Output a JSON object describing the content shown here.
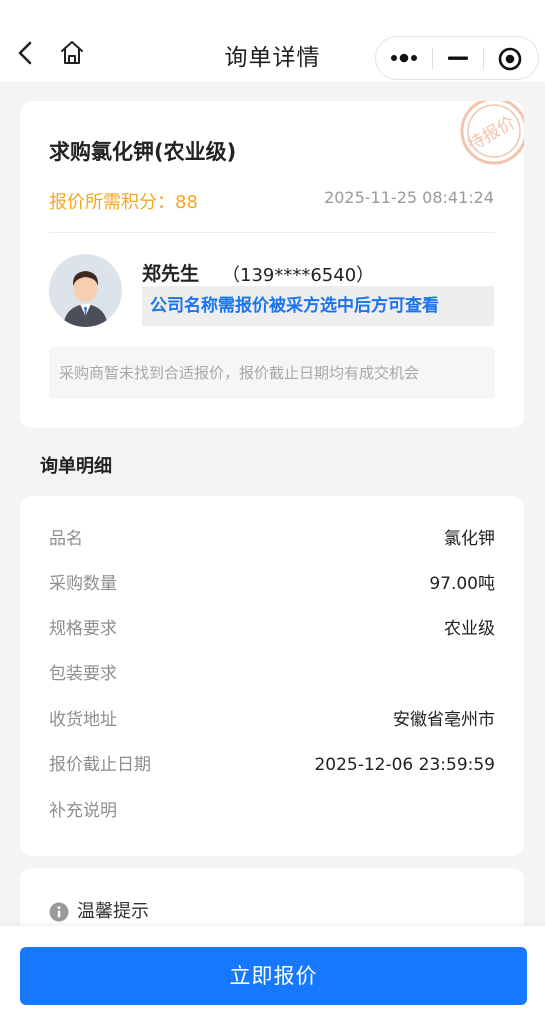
{
  "navbar": {
    "title": "询单详情",
    "back_icon": "chevron-left-icon",
    "home_icon": "home-icon",
    "capsule": {
      "more_icon": "more-dots-icon",
      "minimize_icon": "minimize-icon",
      "close_icon": "target-close-icon"
    }
  },
  "inquiry": {
    "title": "求购氯化钾(农业级)",
    "points_label": "报价所需积分：",
    "points_value": "88",
    "post_time": "2025-11-25 08:41:24",
    "stamp_text": "待报价",
    "buyer": {
      "name": "郑先生",
      "phone": "（139****6540）",
      "company_hidden_text": "公司名称需报价被采方选中后方可查看"
    },
    "notice": "采购商暂未找到合适报价，报价截止日期均有成交机会"
  },
  "details": {
    "section_title": "询单明细",
    "rows": [
      {
        "label": "品名",
        "value": "氯化钾"
      },
      {
        "label": "采购数量",
        "value": "97.00吨"
      },
      {
        "label": "规格要求",
        "value": "农业级"
      },
      {
        "label": "包装要求",
        "value": ""
      },
      {
        "label": "收货地址",
        "value": "安徽省亳州市"
      },
      {
        "label": "报价截止日期",
        "value": "2025-12-06 23:59:59"
      },
      {
        "label": "补充说明",
        "value": ""
      }
    ]
  },
  "tips": {
    "title": "温馨提示",
    "icon": "info-icon"
  },
  "action": {
    "quote_label": "立即报价"
  },
  "colors": {
    "accent": "#1677ff",
    "points": "#f5a623",
    "stamp": "#f2c4ad"
  }
}
